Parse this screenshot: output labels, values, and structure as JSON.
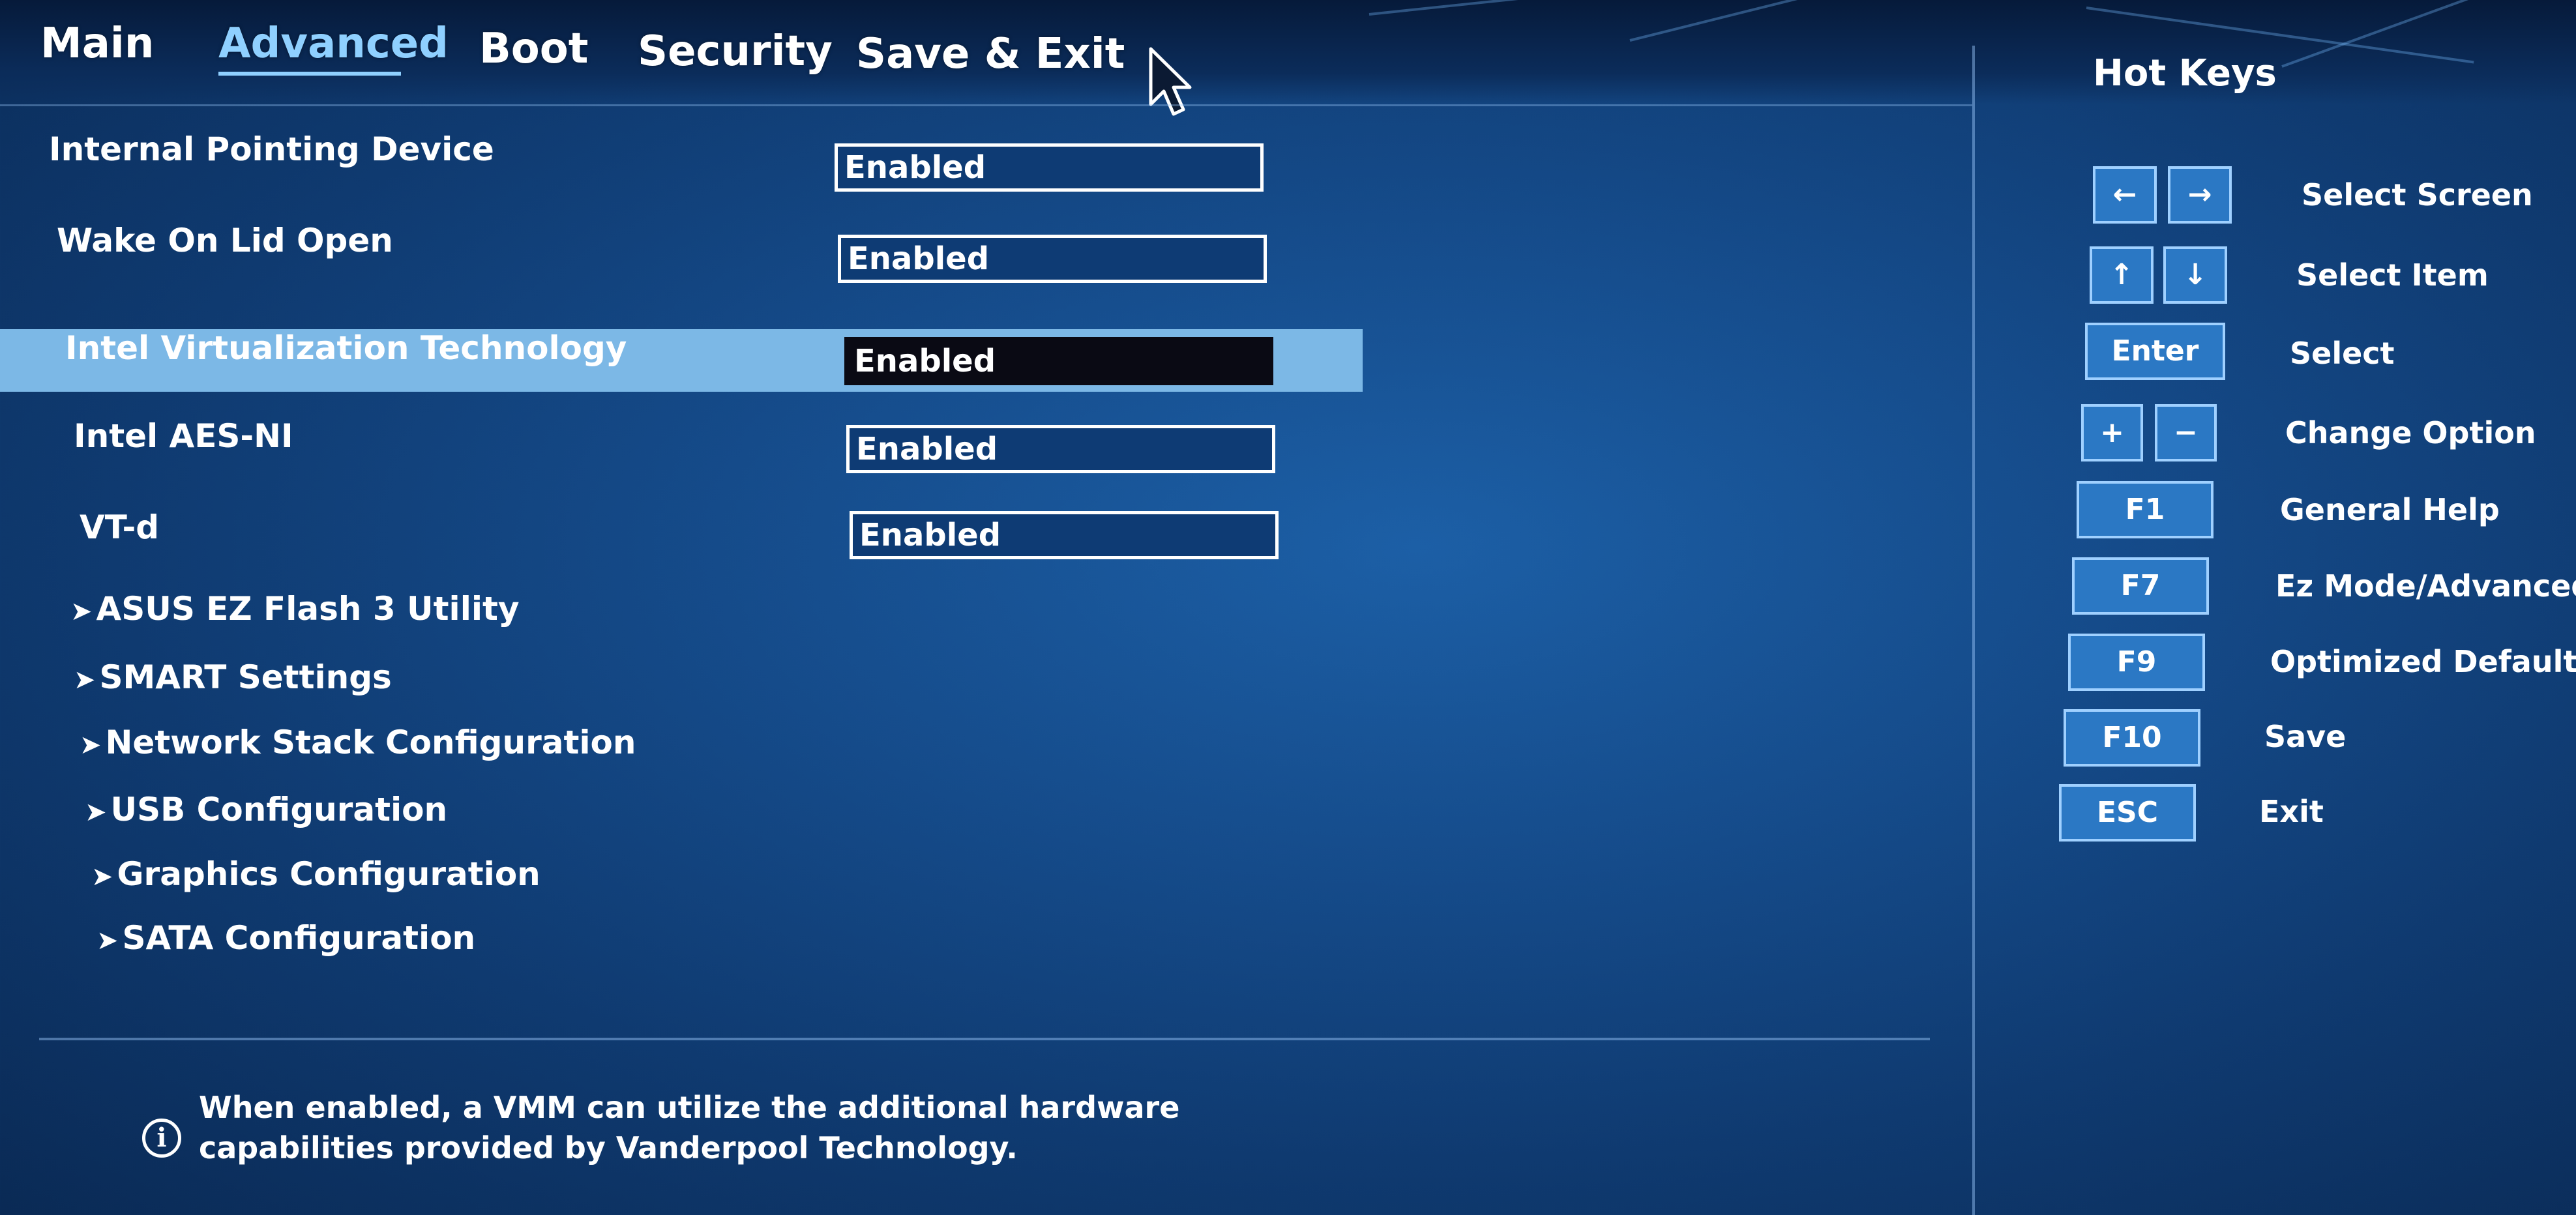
{
  "tabs": [
    {
      "label": "Main"
    },
    {
      "label": "Advanced"
    },
    {
      "label": "Boot"
    },
    {
      "label": "Security"
    },
    {
      "label": "Save & Exit"
    }
  ],
  "active_tab": "Advanced",
  "settings": [
    {
      "label": "Internal Pointing Device",
      "value": "Enabled"
    },
    {
      "label": "Wake On Lid Open",
      "value": "Enabled"
    },
    {
      "label": "Intel Virtualization Technology",
      "value": "Enabled"
    },
    {
      "label": "Intel AES-NI",
      "value": "Enabled"
    },
    {
      "label": "VT-d",
      "value": "Enabled"
    }
  ],
  "selected_setting": "Intel Virtualization Technology",
  "submenus": [
    {
      "label": "ASUS EZ Flash 3 Utility"
    },
    {
      "label": "SMART Settings"
    },
    {
      "label": "Network Stack Configuration"
    },
    {
      "label": "USB Configuration"
    },
    {
      "label": "Graphics Configuration"
    },
    {
      "label": "SATA Configuration"
    }
  ],
  "help_text": "When enabled, a VMM can utilize the additional hardware capabilities provided by Vanderpool Technology.",
  "hotkeys": {
    "title": "Hot Keys",
    "items": [
      {
        "keys": [
          "←",
          "→"
        ],
        "description": "Select Screen"
      },
      {
        "keys": [
          "↑",
          "↓"
        ],
        "description": "Select Item"
      },
      {
        "keys": [
          "Enter"
        ],
        "description": "Select"
      },
      {
        "keys": [
          "+",
          "−"
        ],
        "description": "Change Option"
      },
      {
        "keys": [
          "F1"
        ],
        "description": "General Help"
      },
      {
        "keys": [
          "F7"
        ],
        "description": "Ez Mode/Advanced Mode"
      },
      {
        "keys": [
          "F9"
        ],
        "description": "Optimized Defaults"
      },
      {
        "keys": [
          "F10"
        ],
        "description": "Save"
      },
      {
        "keys": [
          "ESC"
        ],
        "description": "Exit"
      }
    ]
  },
  "colors": {
    "background": "#154b8a",
    "highlight_row": "#7cb8e6",
    "active_tab": "#8fd0ff",
    "key_fill": "#2b78c4",
    "key_border": "#9fd0ff"
  },
  "icons": {
    "submenu_arrow": "chevron-right-icon",
    "info": "info-icon",
    "pointer": "mouse-cursor-icon"
  }
}
